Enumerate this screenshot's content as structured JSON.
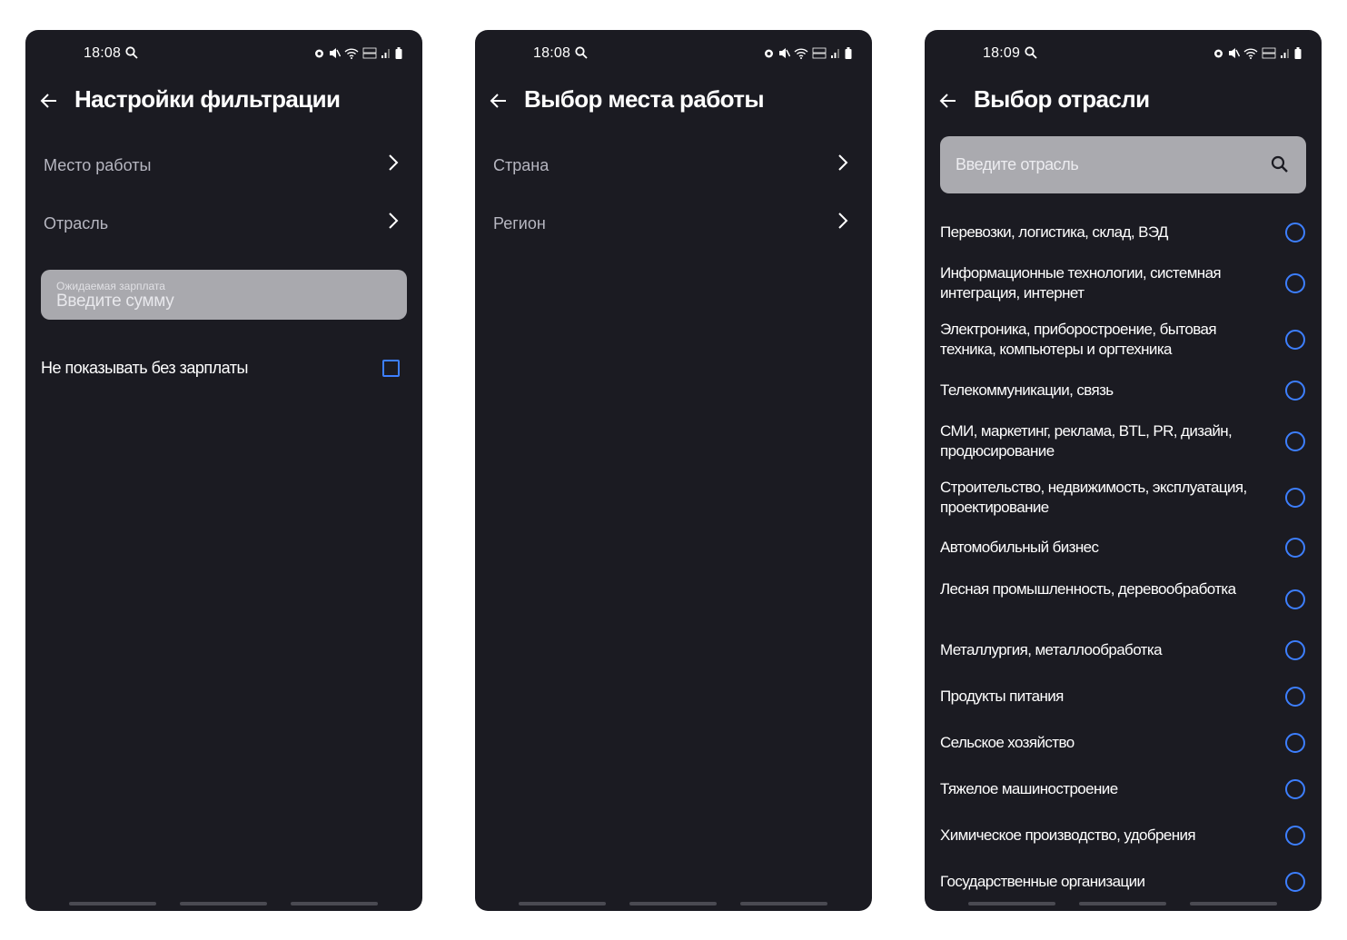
{
  "screens": [
    {
      "status": {
        "time": "18:08"
      },
      "title": "Настройки фильтрации",
      "nav": [
        {
          "label": "Место работы"
        },
        {
          "label": "Отрасль"
        }
      ],
      "salary": {
        "hint": "Ожидаемая зарплата",
        "placeholder": "Введите сумму"
      },
      "no_salary": {
        "label": "Не показывать без зарплаты",
        "checked": false
      }
    },
    {
      "status": {
        "time": "18:08"
      },
      "title": "Выбор места работы",
      "nav": [
        {
          "label": "Страна"
        },
        {
          "label": "Регион"
        }
      ]
    },
    {
      "status": {
        "time": "18:09"
      },
      "title": "Выбор отрасли",
      "search": {
        "placeholder": "Введите отрасль"
      },
      "industries": [
        "Перевозки, логистика, склад, ВЭД",
        "Информационные технологии, системная интеграция, интернет",
        "Электроника, приборостроение, бытовая техника, компьютеры и оргтехника",
        "Телекоммуникации, связь",
        "СМИ, маркетинг, реклама, BTL, PR, дизайн, продюсирование",
        "Строительство, недвижимость, эксплуатация, проектирование",
        "Автомобильный бизнес",
        "Лесная промышленность, деревообработка",
        "Металлургия, металлообработка",
        "Продукты питания",
        "Сельское хозяйство",
        "Тяжелое машиностроение",
        "Химическое производство, удобрения",
        "Государственные организации"
      ]
    }
  ],
  "colors": {
    "background": "#1b1b22",
    "accent": "#3d7fff",
    "input_bg": "#aaaaaf",
    "secondary_text": "#b6b6c0"
  },
  "icons": [
    "back-arrow-icon",
    "chevron-right-icon",
    "search-icon",
    "radio-icon",
    "checkbox-icon",
    "alarm-icon",
    "mute-icon",
    "wifi-icon",
    "volte-icon",
    "signal-icon",
    "battery-icon"
  ]
}
